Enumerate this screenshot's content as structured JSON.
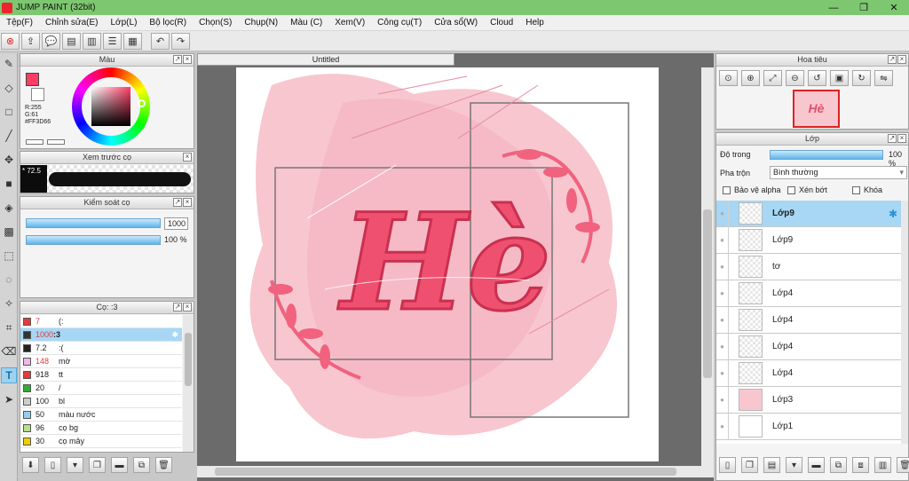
{
  "window": {
    "title": "JUMP PAINT (32bit)",
    "minimize": "—",
    "maximize": "❐",
    "close": "✕"
  },
  "menu": [
    "Tệp(F)",
    "Chỉnh sửa(E)",
    "Lớp(L)",
    "Bộ lọc(R)",
    "Chọn(S)",
    "Chụp(N)",
    "Màu (C)",
    "Xem(V)",
    "Công cụ(T)",
    "Cửa sổ(W)",
    "Cloud",
    "Help"
  ],
  "colors": {
    "current": "#FF3D66",
    "titlebar": "#7dc770",
    "selection": "#a7d7f5"
  },
  "color_panel": {
    "title": "Màu",
    "r": "R:255",
    "g": "G:61",
    "hex": "#FF3D66"
  },
  "brush_preview": {
    "title": "Xem trước cọ",
    "size": "72.5"
  },
  "brush_control": {
    "title": "Kiểm soát cọ",
    "size_value": "1000",
    "opacity_value": "100 %"
  },
  "brushes": {
    "title": "Cọ: :3",
    "items": [
      {
        "size": "7",
        "name": "(:",
        "color": "#e23b3b"
      },
      {
        "size": "1000",
        "name": ":3",
        "color": "#333333"
      },
      {
        "size": "7.2",
        "name": ":(",
        "color": "#222222"
      },
      {
        "size": "148",
        "name": "mờ",
        "color": "#f0b8e8"
      },
      {
        "size": "918",
        "name": "tt",
        "color": "#e23b3b"
      },
      {
        "size": "20",
        "name": "/",
        "color": "#2fae2f"
      },
      {
        "size": "100",
        "name": "bl",
        "color": "#cccccc"
      },
      {
        "size": "50",
        "name": "màu nước",
        "color": "#8fd0f0"
      },
      {
        "size": "96",
        "name": "cọ bg",
        "color": "#b8e08a"
      },
      {
        "size": "30",
        "name": "cọ mây",
        "color": "#f0d000"
      }
    ]
  },
  "document": {
    "tab": "Untitled",
    "artwork_text": "Hè"
  },
  "navigator": {
    "title": "Hoa tiêu"
  },
  "layers_panel": {
    "title": "Lớp",
    "opacity_label": "Độ trong",
    "opacity_value": "100 %",
    "blend_label": "Pha trộn",
    "blend_value": "Bình thường",
    "protect_alpha": "Bảo vệ alpha",
    "clip": "Xén bớt",
    "lock": "Khóa",
    "layers": [
      "Lớp9",
      "Lớp9",
      "tơ",
      "Lớp4",
      "Lớp4",
      "Lớp4",
      "Lớp4",
      "Lớp3",
      "Lớp1"
    ]
  }
}
